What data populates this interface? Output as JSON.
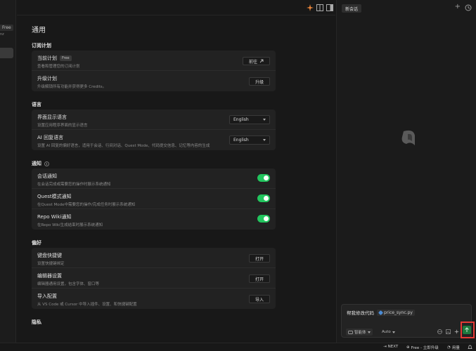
{
  "left_strip": {
    "plan_badge": "Free",
    "text": "nz"
  },
  "main": {
    "title": "通用",
    "sections": {
      "plan": {
        "title": "订阅计划",
        "current": {
          "title": "当前计划",
          "badge": "Free",
          "desc": "查看和管理您的订阅计划",
          "button": "前往"
        },
        "upgrade": {
          "title": "升级计划",
          "desc": "升级解锁所有功能并获得更多 Credits。",
          "button": "升级"
        }
      },
      "language": {
        "title": "语言",
        "ui": {
          "title": "界面显示语言",
          "desc": "设置应用程序界面的显示语言",
          "value": "English"
        },
        "ai": {
          "title": "AI 回复语言",
          "desc": "设置 AI 回复的偏好语言，适用于会话、行间对话、Quest Mode、代码提交信息、记忆等内容的生成",
          "value": "English"
        }
      },
      "notify": {
        "title": "通知",
        "session": {
          "title": "会话通知",
          "desc": "在会话完成或需要您的操作时展示系统通知",
          "on": true
        },
        "quest": {
          "title": "Quest模式通知",
          "desc": "在Quest Mode中需要您的操作/完成任务时展示系统通知",
          "on": true
        },
        "repo": {
          "title": "Repo Wiki通知",
          "desc": "在Repo Wiki生成结束时展示系统通知",
          "on": true
        }
      },
      "prefs": {
        "title": "偏好",
        "keys": {
          "title": "键盘快捷键",
          "desc": "设置快捷键绑定",
          "button": "打开"
        },
        "editor": {
          "title": "编辑器设置",
          "desc": "编辑器通用设置，包含字体、窗口等",
          "button": "打开"
        },
        "import": {
          "title": "导入配置",
          "desc": "从 VS Code 或 Cursor 中导入插件、设置、和快捷键配置",
          "button": "导入"
        }
      },
      "privacy": {
        "title": "隐私"
      }
    }
  },
  "chat": {
    "tab": "新会话",
    "plus": "+",
    "prompt": "帮我修改代码",
    "file": "price_sync.py",
    "agent": "智能体",
    "model": "Auto"
  },
  "status": {
    "next": "NEXT",
    "plan": "Free - 立即升级",
    "usage": "用量"
  },
  "colors": {
    "accent": "#22c55e",
    "highlight": "#e53935",
    "send": "#1e7a3e"
  }
}
